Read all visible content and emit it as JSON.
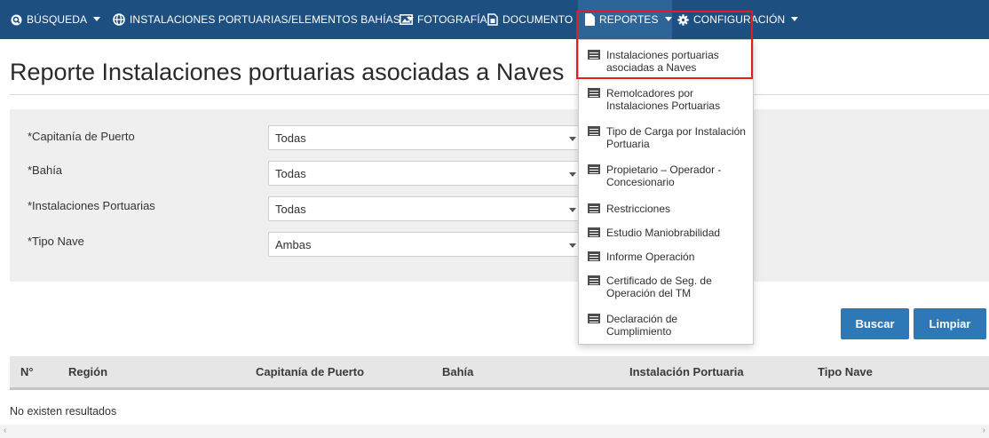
{
  "nav": {
    "items": [
      {
        "label": "BÚSQUEDA",
        "icon": "search-icon"
      },
      {
        "label": "INSTALACIONES PORTUARIAS/ELEMENTOS BAHÍAS",
        "icon": "globe-icon"
      },
      {
        "label": "FOTOGRAFÍA",
        "icon": "image-icon"
      },
      {
        "label": "DOCUMENTO",
        "icon": "document-icon"
      },
      {
        "label": "REPORTES",
        "icon": "file-icon"
      },
      {
        "label": "CONFIGURACIÓN",
        "icon": "gear-icon"
      }
    ]
  },
  "page": {
    "title": "Reporte Instalaciones portuarias asociadas a Naves"
  },
  "filters": [
    {
      "label": "*Capitanía de Puerto",
      "value": "Todas"
    },
    {
      "label": "*Bahía",
      "value": "Todas"
    },
    {
      "label": "*Instalaciones Portuarias",
      "value": "Todas"
    },
    {
      "label": "*Tipo Nave",
      "value": "Ambas"
    }
  ],
  "buttons": {
    "search": "Buscar",
    "clear": "Limpiar"
  },
  "table": {
    "headers": [
      "N°",
      "Región",
      "Capitanía de Puerto",
      "Bahía",
      "Instalación Portuaria",
      "Tipo Nave"
    ],
    "empty_message": "No existen resultados"
  },
  "dropdown": {
    "items": [
      {
        "lines": [
          "Instalaciones portuarias",
          "asociadas a Naves"
        ],
        "icon": "report-list-icon"
      },
      {
        "lines": [
          "Remolcadores por",
          "Instalaciones Portuarias"
        ],
        "icon": "report-list-icon"
      },
      {
        "lines": [
          "Tipo de Carga por Instalación",
          "Portuaria"
        ],
        "icon": "report-list-icon"
      },
      {
        "lines": [
          "Propietario – Operador -",
          "Concesionario"
        ],
        "icon": "report-list-icon"
      },
      {
        "lines": [
          "Restricciones"
        ],
        "icon": "report-list-icon"
      },
      {
        "lines": [
          "Estudio Maniobrabilidad"
        ],
        "icon": "report-list-icon"
      },
      {
        "lines": [
          "Informe Operación"
        ],
        "icon": "report-list-icon"
      },
      {
        "lines": [
          "Certificado de Seg. de",
          "Operación del TM"
        ],
        "icon": "report-list-icon"
      },
      {
        "lines": [
          "Declaración de",
          "Cumplimiento"
        ],
        "icon": "report-list-icon"
      }
    ]
  },
  "colors": {
    "navbar": "#1d4f80",
    "accent_button": "#2e78b7",
    "highlight": "#e11d1d"
  }
}
